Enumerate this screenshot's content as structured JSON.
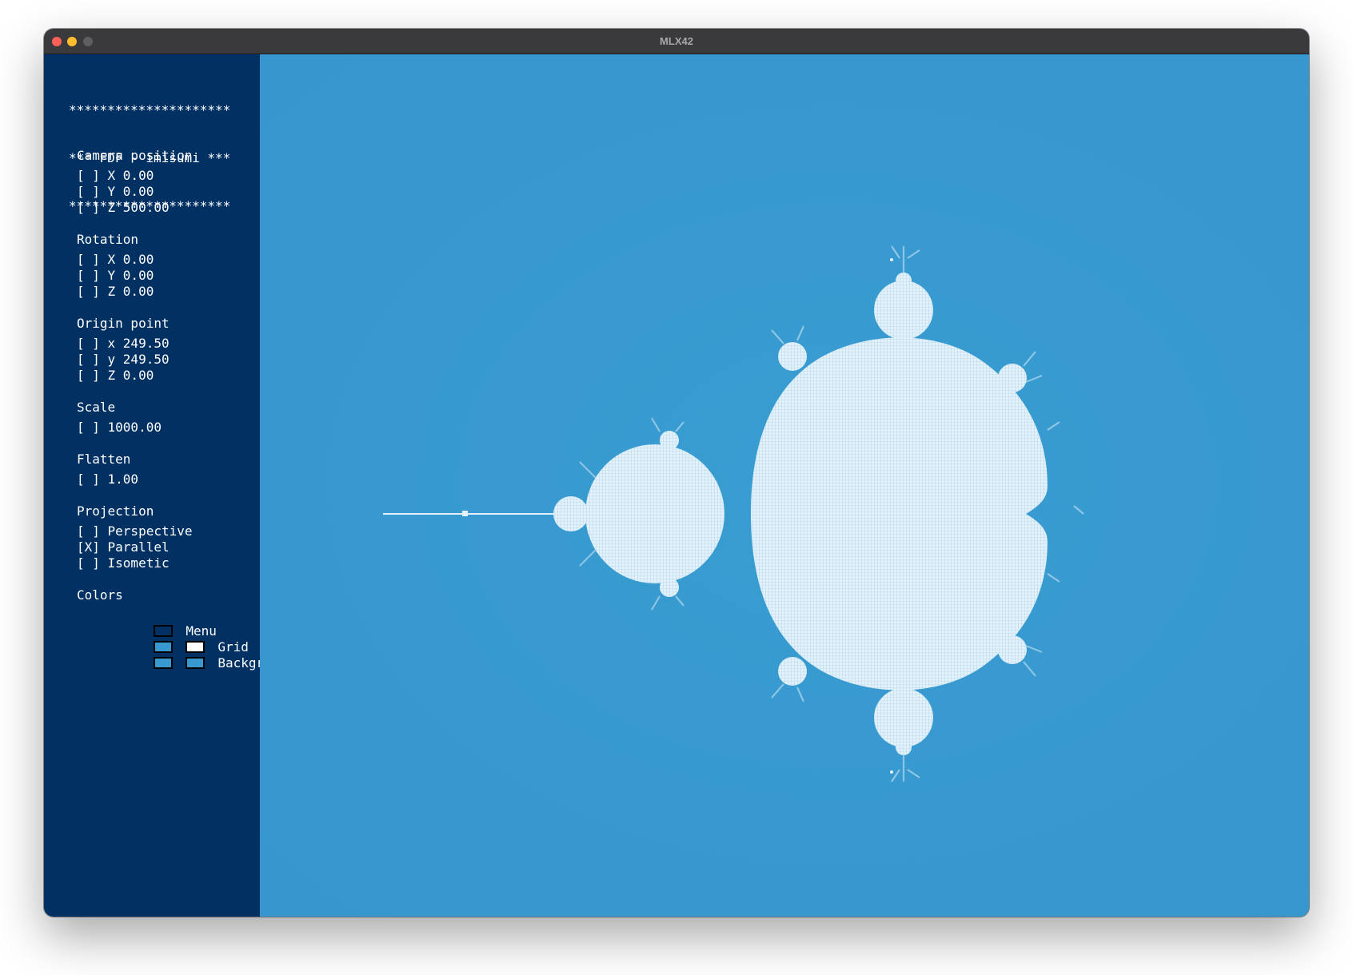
{
  "window": {
    "title": "MLX42"
  },
  "banner": {
    "line1": "*********************",
    "line2": "*** FDF - imisumi ***",
    "line3": "*********************"
  },
  "camera_position": {
    "title": "Camera position",
    "x": "[ ] X 0.00",
    "y": "[ ] Y 0.00",
    "z": "[ ] Z 500.00"
  },
  "rotation": {
    "title": "Rotation",
    "x": "[ ] X 0.00",
    "y": "[ ] Y 0.00",
    "z": "[ ] Z 0.00"
  },
  "origin_point": {
    "title": "Origin point",
    "x": "[ ] x 249.50",
    "y": "[ ] y 249.50",
    "z": "[ ] Z 0.00"
  },
  "scale": {
    "title": "Scale",
    "value": "[ ] 1000.00"
  },
  "flatten": {
    "title": "Flatten",
    "value": "[ ] 1.00"
  },
  "projection": {
    "title": "Projection",
    "perspective": "[ ] Perspective",
    "parallel": "[X] Parallel",
    "isometic": "[ ] Isometic"
  },
  "colors": {
    "title": "Colors",
    "menu_label": "Menu",
    "grid_label": "Grid",
    "background_label": "Background",
    "menu_color": "#013063",
    "grid_color_1": "#3799cf",
    "grid_color_2": "#ffffff",
    "background_color_1": "#3799cf",
    "background_color_2": "#3799cf"
  }
}
